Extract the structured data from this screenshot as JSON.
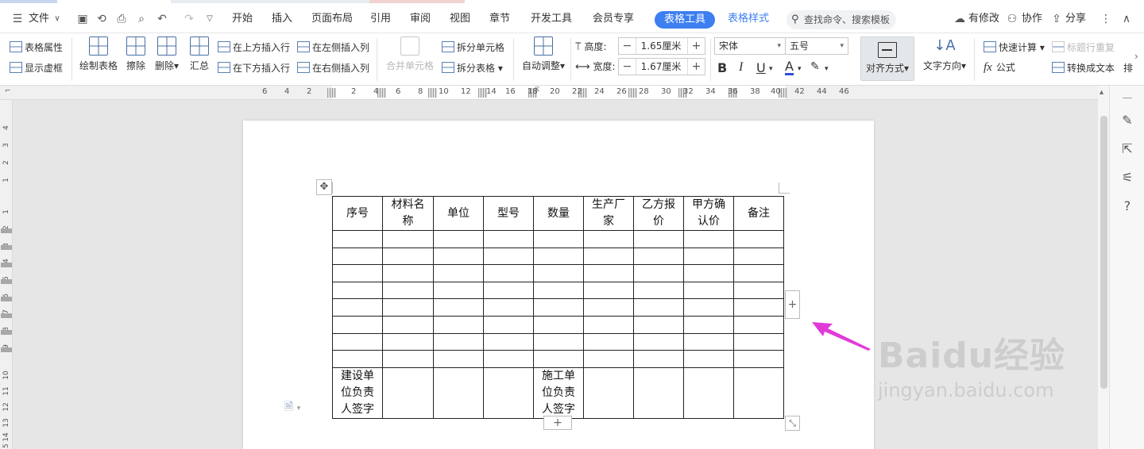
{
  "menubar": {
    "file_label": "文件",
    "tabs": [
      "开始",
      "插入",
      "页面布局",
      "引用",
      "审阅",
      "视图",
      "章节",
      "开发工具",
      "会员专享"
    ],
    "active_tab": "表格工具",
    "table_style_tab": "表格样式",
    "search_placeholder": "查找命令、搜索模板",
    "right_items": [
      "有修改",
      "协作",
      "分享"
    ]
  },
  "ribbon": {
    "table_props": "表格属性",
    "show_gridlines": "显示虚框",
    "draw_table": "绘制表格",
    "erase": "擦除",
    "delete": "删除",
    "summary": "汇总",
    "insert_above": "在上方插入行",
    "insert_below": "在下方插入行",
    "insert_left": "在左侧插入列",
    "insert_right": "在右侧插入列",
    "merge_cells": "合并单元格",
    "split_cells": "拆分单元格",
    "split_table": "拆分表格",
    "auto_fit": "自动调整",
    "height_label": "高度:",
    "height_value": "1.65厘米",
    "width_label": "宽度:",
    "width_value": "1.67厘米",
    "font_name": "宋体",
    "font_size": "五号",
    "align": "对齐方式",
    "text_direction": "文字方向",
    "quick_calc": "快速计算",
    "repeat_header": "标题行重复",
    "formula": "公式",
    "to_text": "转换成文本",
    "more": "排"
  },
  "ruler": {
    "h_numbers": [
      "6",
      "4",
      "2",
      "2",
      "4",
      "6",
      "8",
      "10",
      "12",
      "14",
      "16",
      "18",
      "20",
      "22",
      "24",
      "26",
      "28",
      "30",
      "32",
      "34",
      "36",
      "38",
      "40",
      "42",
      "44",
      "46"
    ],
    "v_numbers": [
      "4",
      "3",
      "2",
      "1",
      "1",
      "2",
      "3",
      "4",
      "5",
      "6",
      "7",
      "8",
      "9",
      "10",
      "11",
      "12",
      "13",
      "14",
      "15"
    ]
  },
  "table": {
    "headers": [
      "序号",
      "材料名称",
      "单位",
      "型号",
      "数量",
      "生产厂家",
      "乙方报价",
      "甲方确认价",
      "备注"
    ],
    "empty_rows": 8,
    "footer": [
      "建设单位负责人签字",
      "",
      "",
      "",
      "施工单位负责人签字",
      "",
      "",
      "",
      ""
    ]
  },
  "watermark": {
    "brand": "Baidu经验",
    "url": "jingyan.baidu.com"
  },
  "colors": {
    "accent": "#3d7ff1",
    "arrow": "#e23ad9"
  }
}
